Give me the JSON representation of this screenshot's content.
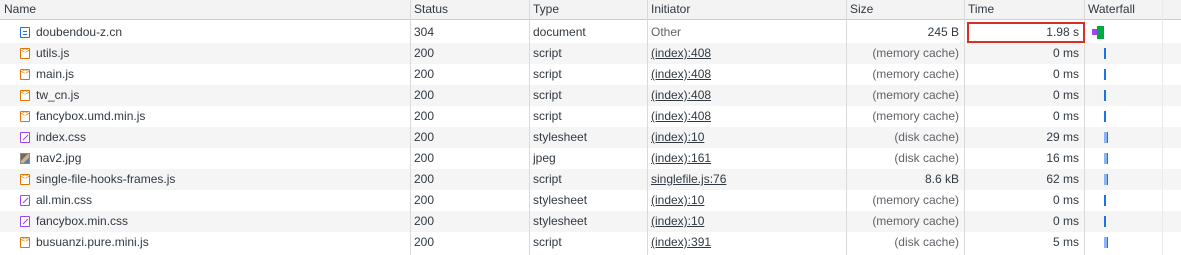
{
  "columns": {
    "name": "Name",
    "status": "Status",
    "type": "Type",
    "initiator": "Initiator",
    "size": "Size",
    "time": "Time",
    "waterfall": "Waterfall"
  },
  "rows": [
    {
      "name": "doubendou-z.cn",
      "icon": "document-icon",
      "status": "304",
      "type": "document",
      "initiator": "Other",
      "initiator_link": false,
      "size": "245 B",
      "time": "1.98 s"
    },
    {
      "name": "utils.js",
      "icon": "script-icon",
      "status": "200",
      "type": "script",
      "initiator": "(index):408",
      "initiator_link": true,
      "size": "(memory cache)",
      "time": "0 ms"
    },
    {
      "name": "main.js",
      "icon": "script-icon",
      "status": "200",
      "type": "script",
      "initiator": "(index):408",
      "initiator_link": true,
      "size": "(memory cache)",
      "time": "0 ms"
    },
    {
      "name": "tw_cn.js",
      "icon": "script-icon",
      "status": "200",
      "type": "script",
      "initiator": "(index):408",
      "initiator_link": true,
      "size": "(memory cache)",
      "time": "0 ms"
    },
    {
      "name": "fancybox.umd.min.js",
      "icon": "script-icon",
      "status": "200",
      "type": "script",
      "initiator": "(index):408",
      "initiator_link": true,
      "size": "(memory cache)",
      "time": "0 ms"
    },
    {
      "name": "index.css",
      "icon": "stylesheet-icon",
      "status": "200",
      "type": "stylesheet",
      "initiator": "(index):10",
      "initiator_link": true,
      "size": "(disk cache)",
      "time": "29 ms"
    },
    {
      "name": "nav2.jpg",
      "icon": "image-icon",
      "status": "200",
      "type": "jpeg",
      "initiator": "(index):161",
      "initiator_link": true,
      "size": "(disk cache)",
      "time": "16 ms"
    },
    {
      "name": "single-file-hooks-frames.js",
      "icon": "script-icon",
      "status": "200",
      "type": "script",
      "initiator": "singlefile.js:76",
      "initiator_link": true,
      "size": "8.6 kB",
      "time": "62 ms"
    },
    {
      "name": "all.min.css",
      "icon": "stylesheet-icon",
      "status": "200",
      "type": "stylesheet",
      "initiator": "(index):10",
      "initiator_link": true,
      "size": "(memory cache)",
      "time": "0 ms"
    },
    {
      "name": "fancybox.min.css",
      "icon": "stylesheet-icon",
      "status": "200",
      "type": "stylesheet",
      "initiator": "(index):10",
      "initiator_link": true,
      "size": "(memory cache)",
      "time": "0 ms"
    },
    {
      "name": "busuanzi.pure.mini.js",
      "icon": "script-icon",
      "status": "200",
      "type": "script",
      "initiator": "(index):391",
      "initiator_link": true,
      "size": "(disk cache)",
      "time": "5 ms"
    }
  ],
  "colors": {
    "highlight": "#d93025",
    "waterfall_waiting": "#00a846",
    "waterfall_download": "#1a73e8",
    "waterfall_queue": "#a142f4"
  }
}
